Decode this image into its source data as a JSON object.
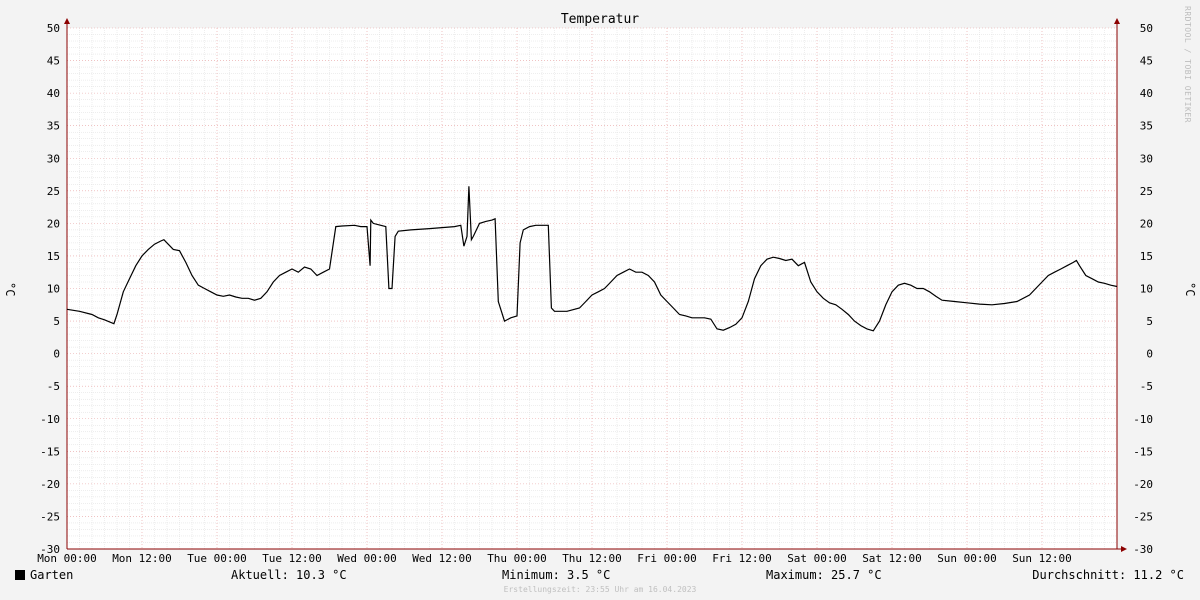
{
  "chart_data": {
    "type": "line",
    "title": "Temperatur",
    "ylabel": "°C",
    "ylim": [
      -30,
      50
    ],
    "ymajor_step": 5,
    "yticks": [
      50,
      45,
      40,
      35,
      30,
      25,
      20,
      15,
      10,
      5,
      0,
      -5,
      -10,
      -15,
      -20,
      -25,
      -30
    ],
    "xlim_hours": [
      0,
      168
    ],
    "xtick_labels": [
      "Mon 00:00",
      "Mon 12:00",
      "Tue 00:00",
      "Tue 12:00",
      "Wed 00:00",
      "Wed 12:00",
      "Thu 00:00",
      "Thu 12:00",
      "Fri 00:00",
      "Fri 12:00",
      "Sat 00:00",
      "Sat 12:00",
      "Sun 00:00",
      "Sun 12:00"
    ],
    "grid": true,
    "series": [
      {
        "name": "Garten",
        "color": "#000000",
        "points": [
          [
            0,
            6.8
          ],
          [
            2,
            6.5
          ],
          [
            4,
            6.0
          ],
          [
            5,
            5.5
          ],
          [
            6,
            5.2
          ],
          [
            7,
            4.8
          ],
          [
            7.5,
            4.6
          ],
          [
            8,
            6.0
          ],
          [
            9,
            9.5
          ],
          [
            10,
            11.5
          ],
          [
            11,
            13.5
          ],
          [
            12,
            15.0
          ],
          [
            13,
            16.0
          ],
          [
            14,
            16.8
          ],
          [
            15,
            17.3
          ],
          [
            15.5,
            17.5
          ],
          [
            16,
            17.0
          ],
          [
            17,
            16.0
          ],
          [
            18,
            15.8
          ],
          [
            19,
            14.0
          ],
          [
            20,
            12.0
          ],
          [
            21,
            10.5
          ],
          [
            22,
            10.0
          ],
          [
            23,
            9.5
          ],
          [
            24,
            9.0
          ],
          [
            25,
            8.8
          ],
          [
            26,
            9.0
          ],
          [
            27,
            8.7
          ],
          [
            28,
            8.5
          ],
          [
            29,
            8.5
          ],
          [
            30,
            8.2
          ],
          [
            31,
            8.5
          ],
          [
            32,
            9.5
          ],
          [
            33,
            11.0
          ],
          [
            34,
            12.0
          ],
          [
            35,
            12.5
          ],
          [
            36,
            13.0
          ],
          [
            37,
            12.5
          ],
          [
            38,
            13.3
          ],
          [
            39,
            13.0
          ],
          [
            40,
            12.0
          ],
          [
            41,
            12.5
          ],
          [
            42,
            13.0
          ],
          [
            43,
            19.5
          ],
          [
            44,
            19.6
          ],
          [
            46,
            19.7
          ],
          [
            47,
            19.5
          ],
          [
            48,
            19.5
          ],
          [
            48.5,
            13.5
          ],
          [
            48.6,
            20.5
          ],
          [
            49,
            20.0
          ],
          [
            51,
            19.5
          ],
          [
            51.5,
            10.0
          ],
          [
            52,
            10.0
          ],
          [
            52.5,
            18.0
          ],
          [
            53,
            18.8
          ],
          [
            55,
            19.0
          ],
          [
            58,
            19.2
          ],
          [
            62,
            19.5
          ],
          [
            63,
            19.7
          ],
          [
            63.5,
            16.5
          ],
          [
            64,
            18.0
          ],
          [
            64.3,
            25.7
          ],
          [
            64.7,
            17.5
          ],
          [
            65,
            18.0
          ],
          [
            66,
            20.0
          ],
          [
            67,
            20.3
          ],
          [
            68,
            20.5
          ],
          [
            68.5,
            20.7
          ],
          [
            69,
            8.0
          ],
          [
            69.5,
            6.5
          ],
          [
            70,
            5.0
          ],
          [
            71,
            5.5
          ],
          [
            72,
            5.8
          ],
          [
            72.5,
            17.0
          ],
          [
            73,
            19.0
          ],
          [
            74,
            19.5
          ],
          [
            75,
            19.7
          ],
          [
            76,
            19.7
          ],
          [
            77,
            19.7
          ],
          [
            77.5,
            7.0
          ],
          [
            78,
            6.5
          ],
          [
            80,
            6.5
          ],
          [
            82,
            7.0
          ],
          [
            83,
            8.0
          ],
          [
            84,
            9.0
          ],
          [
            85,
            9.5
          ],
          [
            86,
            10.0
          ],
          [
            87,
            11.0
          ],
          [
            88,
            12.0
          ],
          [
            89,
            12.5
          ],
          [
            90,
            13.0
          ],
          [
            91,
            12.5
          ],
          [
            92,
            12.5
          ],
          [
            93,
            12.0
          ],
          [
            94,
            11.0
          ],
          [
            95,
            9.0
          ],
          [
            96,
            8.0
          ],
          [
            97,
            7.0
          ],
          [
            98,
            6.0
          ],
          [
            99,
            5.8
          ],
          [
            100,
            5.5
          ],
          [
            101,
            5.5
          ],
          [
            102,
            5.5
          ],
          [
            103,
            5.3
          ],
          [
            104,
            3.8
          ],
          [
            105,
            3.6
          ],
          [
            106,
            4.0
          ],
          [
            107,
            4.5
          ],
          [
            108,
            5.5
          ],
          [
            109,
            8.0
          ],
          [
            110,
            11.5
          ],
          [
            111,
            13.5
          ],
          [
            112,
            14.5
          ],
          [
            113,
            14.8
          ],
          [
            114,
            14.6
          ],
          [
            115,
            14.3
          ],
          [
            116,
            14.5
          ],
          [
            117,
            13.5
          ],
          [
            118,
            14.0
          ],
          [
            119,
            11.0
          ],
          [
            120,
            9.5
          ],
          [
            121,
            8.5
          ],
          [
            122,
            7.8
          ],
          [
            123,
            7.5
          ],
          [
            124,
            6.8
          ],
          [
            125,
            6.0
          ],
          [
            126,
            5.0
          ],
          [
            127,
            4.3
          ],
          [
            128,
            3.8
          ],
          [
            129,
            3.5
          ],
          [
            130,
            5.0
          ],
          [
            131,
            7.5
          ],
          [
            132,
            9.5
          ],
          [
            133,
            10.5
          ],
          [
            134,
            10.8
          ],
          [
            135,
            10.5
          ],
          [
            136,
            10.0
          ],
          [
            137,
            10.0
          ],
          [
            138,
            9.5
          ],
          [
            139,
            8.8
          ],
          [
            140,
            8.2
          ],
          [
            142,
            8.0
          ],
          [
            144,
            7.8
          ],
          [
            146,
            7.6
          ],
          [
            148,
            7.5
          ],
          [
            150,
            7.7
          ],
          [
            152,
            8.0
          ],
          [
            154,
            9.0
          ],
          [
            156,
            11.0
          ],
          [
            157,
            12.0
          ],
          [
            158,
            12.5
          ],
          [
            159,
            13.0
          ],
          [
            160,
            13.5
          ],
          [
            161,
            14.0
          ],
          [
            161.5,
            14.3
          ],
          [
            162,
            13.5
          ],
          [
            163,
            12.0
          ],
          [
            164,
            11.5
          ],
          [
            165,
            11.0
          ],
          [
            166,
            10.8
          ],
          [
            167,
            10.5
          ],
          [
            168,
            10.3
          ]
        ]
      }
    ]
  },
  "legend": {
    "series_name": "Garten",
    "current": "Aktuell: 10.3 °C",
    "minimum": "Minimum: 3.5 °C",
    "maximum": "Maximum: 25.7 °C",
    "average": "Durchschnitt: 11.2 °C"
  },
  "footer": "Erstellungszeit: 23:55 Uhr am 16.04.2023",
  "watermark": "RRDTOOL / TOBI OETIKER",
  "colors": {
    "background": "#f3f3f3",
    "plot": "#ffffff",
    "minor_grid": "#dcdcdc",
    "major_grid": "#e8a0a0",
    "axis": "#8b0000",
    "line": "#000000"
  }
}
